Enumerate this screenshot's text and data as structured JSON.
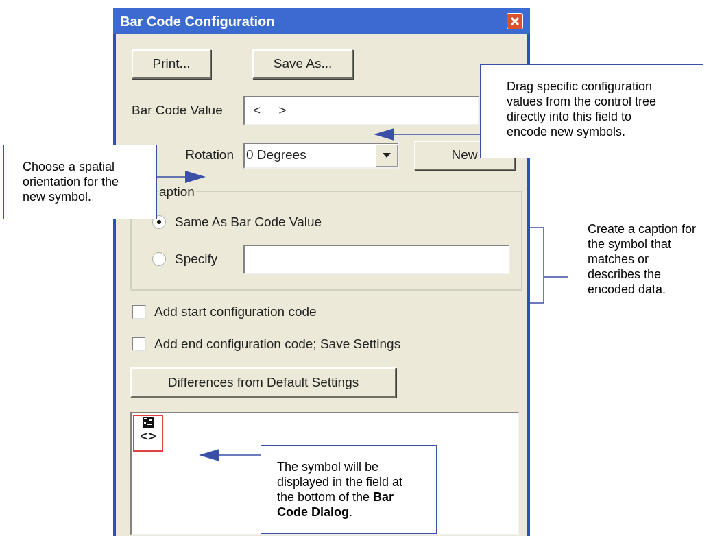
{
  "window": {
    "title": "Bar Code Configuration"
  },
  "buttons": [
    {
      "label": "Print..."
    },
    {
      "label": "Save As..."
    }
  ],
  "bar_code_value": {
    "label": "Bar Code Value",
    "value": "<     >"
  },
  "rotation": {
    "label": "Rotation",
    "value": "0 Degrees"
  },
  "new_button": {
    "label": "New"
  },
  "caption": {
    "legend": "aption",
    "options": [
      {
        "label": "Same As Bar Code Value",
        "selected": true
      },
      {
        "label": "Specify",
        "selected": false
      }
    ]
  },
  "checkboxes": [
    {
      "label": "Add start configuration code",
      "checked": false
    },
    {
      "label": "Add end configuration code; Save Settings",
      "checked": false
    }
  ],
  "differences_button": {
    "label": "Differences from Default Settings"
  },
  "preview": {
    "symbol_text": "<>"
  },
  "callouts": [
    {
      "text": "Drag specific configuration values from the control tree directly into this field to encode new symbols."
    },
    {
      "text": "Choose a spatial orientation for the new symbol."
    },
    {
      "text": "Create a caption for the symbol that matches or describes the encoded data."
    },
    {
      "text": "The symbol will be displayed in the field at the bottom of the **Bar Code Dialog**."
    }
  ]
}
